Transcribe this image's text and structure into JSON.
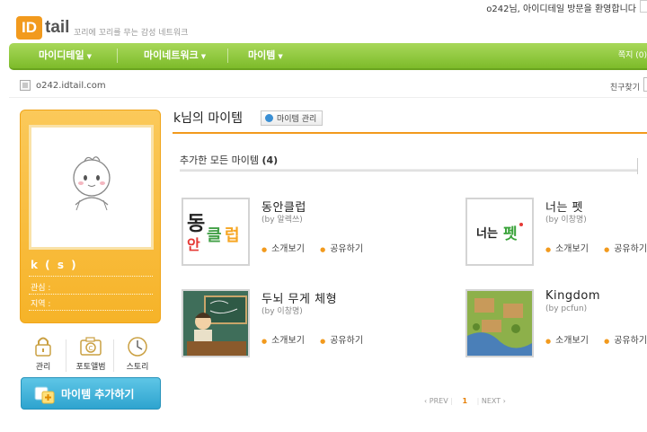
{
  "header": {
    "logo_id": "ID",
    "logo_tail": "tail",
    "slogan": "꼬리에 꼬리를 무는 감성 네트워크",
    "welcome": "o242님, 아이디테일 방문을 환영합니다"
  },
  "nav": {
    "items": [
      {
        "label": "마이디테일"
      },
      {
        "label": "마이네트워크"
      },
      {
        "label": "마이템"
      }
    ],
    "right_label": "쪽지 (0)"
  },
  "url": {
    "text": "o242.idtail.com",
    "friend_search": "친구찾기"
  },
  "profile": {
    "name": "k ( s )",
    "interest_label": "관심 :",
    "region_label": "지역 :",
    "quick": [
      {
        "label": "관리",
        "icon": "lock-icon"
      },
      {
        "label": "포토앨범",
        "icon": "camera-icon"
      },
      {
        "label": "스토리",
        "icon": "clock-icon"
      }
    ],
    "add_button": "마이템 추가하기"
  },
  "main": {
    "title": "k님의 마이템",
    "manage_button": "마이템 관리",
    "section_title": "추가한 모든 마이템",
    "section_count": "(4)",
    "items": [
      {
        "name": "동안클럽",
        "by": "(by 알렉쓰)",
        "thumb_text": "동안클럽",
        "intro": "소개보기",
        "share": "공유하기"
      },
      {
        "name": "너는 펫",
        "by": "(by 이창명)",
        "thumb_text": "너는펫",
        "intro": "소개보기",
        "share": "공유하기"
      },
      {
        "name": "두뇌 무게 체형",
        "by": "(by 이창명)",
        "intro": "소개보기",
        "share": "공유하기"
      },
      {
        "name": "Kingdom",
        "by": "(by pcfun)",
        "intro": "소개보기",
        "share": "공유하기"
      }
    ],
    "pager": {
      "prev": "PREV",
      "current": "1",
      "next": "NEXT"
    }
  },
  "colors": {
    "accent": "#f29a1d",
    "nav_green": "#7dbb2a",
    "card_yellow": "#f6b328",
    "button_blue": "#2ea4cf"
  }
}
